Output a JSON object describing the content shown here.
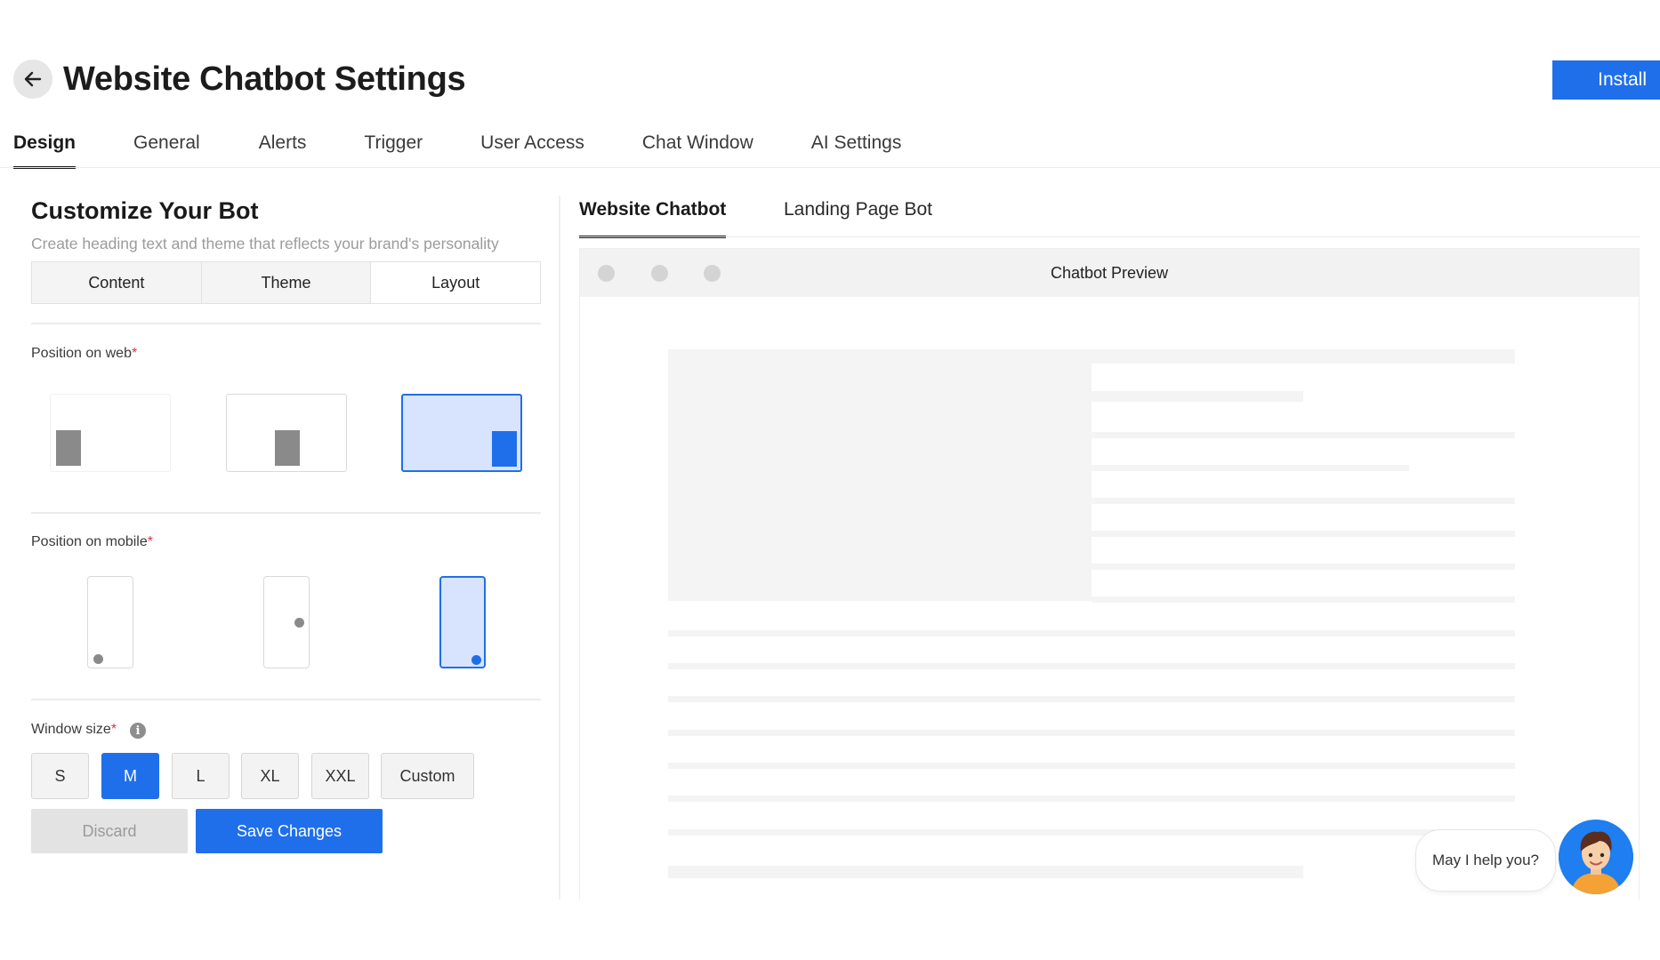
{
  "header": {
    "title": "Website Chatbot Settings",
    "install_label": "Install"
  },
  "main_tabs": [
    {
      "label": "Design",
      "active": true
    },
    {
      "label": "General"
    },
    {
      "label": "Alerts"
    },
    {
      "label": "Trigger"
    },
    {
      "label": "User Access"
    },
    {
      "label": "Chat Window"
    },
    {
      "label": "AI Settings"
    }
  ],
  "customize": {
    "title": "Customize Your Bot",
    "subtitle": "Create heading text and theme that reflects your brand's personality",
    "segments": [
      "Content",
      "Theme",
      "Layout"
    ],
    "selected_segment": "Layout"
  },
  "position_web": {
    "label": "Position on web",
    "required": "*",
    "selected": "right"
  },
  "position_mobile": {
    "label": "Position on mobile",
    "required": "*",
    "selected": "bottom-right"
  },
  "window_size": {
    "label": "Window size",
    "required": "*",
    "info_icon": "info-icon",
    "options": [
      "S",
      "M",
      "L",
      "XL",
      "XXL",
      "Custom"
    ],
    "selected": "M"
  },
  "actions": {
    "discard_label": "Discard",
    "save_label": "Save Changes"
  },
  "right_tabs": [
    {
      "label": "Website Chatbot",
      "active": true
    },
    {
      "label": "Landing Page Bot"
    }
  ],
  "preview": {
    "title": "Chatbot Preview",
    "bubble_text": "May I help you?"
  },
  "colors": {
    "accent": "#1f6feb",
    "selected_bg": "#d8e4fd",
    "required": "#e0333c"
  },
  "icons": {
    "back": "arrow-left-icon",
    "avatar": "bot-avatar-icon"
  }
}
